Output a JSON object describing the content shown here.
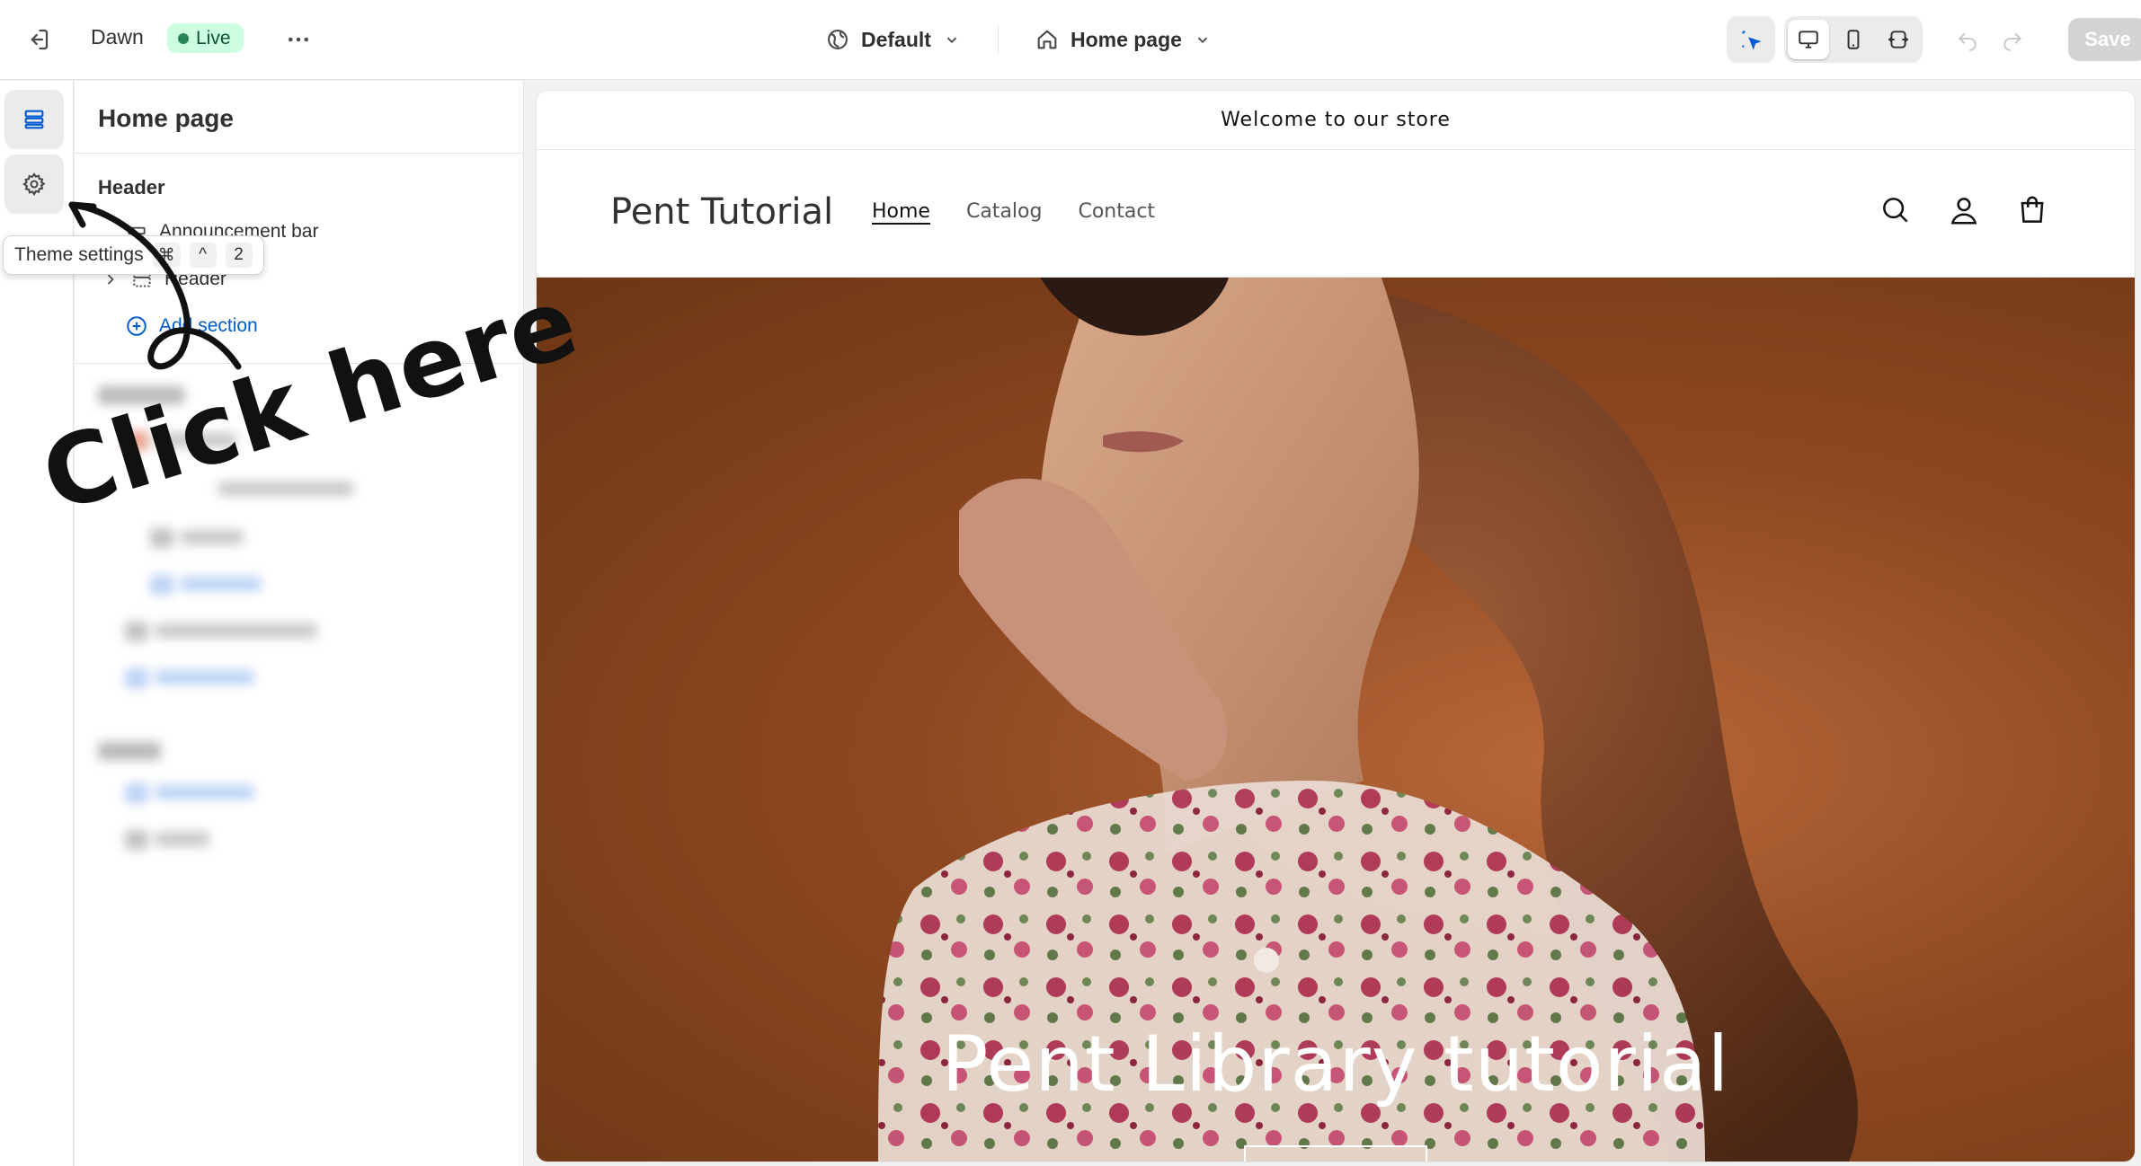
{
  "topbar": {
    "theme_name": "Dawn",
    "status_label": "Live",
    "template_selector": "Default",
    "page_selector": "Home page",
    "save_label": "Save"
  },
  "sidebar_panel": {
    "title": "Home page",
    "header_group": {
      "title": "Header",
      "items": [
        {
          "label": "Announcement bar"
        },
        {
          "label": "Header"
        }
      ],
      "add_section_label": "Add section"
    }
  },
  "tooltip": {
    "label": "Theme settings",
    "shortcut_keys": [
      "⌘",
      "^",
      "2"
    ]
  },
  "preview": {
    "announcement_text": "Welcome to our store",
    "store_name": "Pent Tutorial",
    "nav_items": [
      {
        "label": "Home",
        "active": true
      },
      {
        "label": "Catalog",
        "active": false
      },
      {
        "label": "Contact",
        "active": false
      }
    ],
    "hero_title": "Pent Library tutorial"
  },
  "annotation": {
    "text": "Click here"
  },
  "colors": {
    "live_badge_bg": "#cdfee1",
    "live_badge_text": "#0c5132",
    "link_blue": "#005bd3",
    "save_disabled_bg": "#d4d4d4",
    "hero_bg": "#8e4821"
  },
  "icons": {
    "exit": "exit-icon",
    "more": "more-horizontal-icon",
    "template": "template-icon",
    "home": "home-icon",
    "inspector": "select-cursor-icon",
    "desktop": "desktop-icon",
    "mobile": "mobile-icon",
    "fullwidth": "full-width-icon",
    "undo": "undo-icon",
    "redo": "redo-icon",
    "sections": "sections-icon",
    "settings": "gear-icon",
    "search": "search-icon",
    "account": "account-icon",
    "cart": "cart-icon"
  }
}
